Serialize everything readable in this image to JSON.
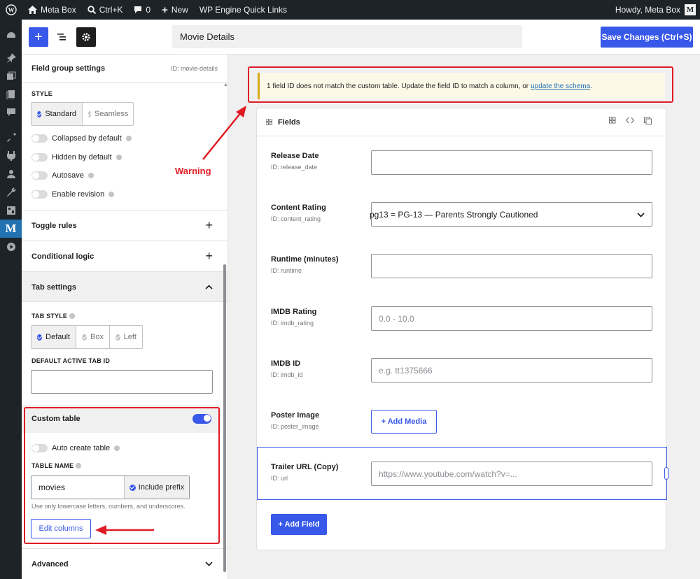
{
  "admin_bar": {
    "site_name": "Meta Box",
    "search_shortcut": "Ctrl+K",
    "comments_count": "0",
    "new_label": "New",
    "quick_links": "WP Engine Quick Links",
    "greeting": "Howdy, Meta Box",
    "avatar_letter": "M"
  },
  "admin_menu": {
    "items": [
      "dashboard-icon",
      "pin-icon",
      "media-icon",
      "pages-icon",
      "comments-icon",
      "appearance-icon",
      "plugins-icon",
      "users-icon",
      "tools-icon",
      "settings-icon",
      "metabox-icon",
      "play-icon"
    ],
    "active_letter": "M"
  },
  "toolbar": {
    "add_label": "+",
    "title_value": "Movie Details",
    "save_label": "Save Changes (Ctrl+S)"
  },
  "sidebar": {
    "header_title": "Field group settings",
    "header_id": "ID: movie-details",
    "style_label": "STYLE",
    "style_options": [
      "Standard",
      "Seamless"
    ],
    "style_selected": "Standard",
    "toggles": [
      {
        "label": "Collapsed by default",
        "on": false
      },
      {
        "label": "Hidden by default",
        "on": false
      },
      {
        "label": "Autosave",
        "on": false
      },
      {
        "label": "Enable revision",
        "on": false
      }
    ],
    "sections": {
      "toggle_rules": "Toggle rules",
      "conditional_logic": "Conditional logic",
      "tab_settings": "Tab settings",
      "advanced": "Advanced"
    },
    "tab_style_label": "TAB STYLE",
    "tab_style_options": [
      "Default",
      "Box",
      "Left"
    ],
    "tab_style_selected": "Default",
    "default_active_tab_label": "DEFAULT ACTIVE TAB ID",
    "default_active_tab_value": "",
    "custom_table": {
      "title": "Custom table",
      "enabled": true,
      "auto_create_label": "Auto create table",
      "table_name_label": "TABLE NAME",
      "table_name_value": "movies",
      "include_prefix_label": "Include prefix",
      "hint": "Use only lowercase letters, numbers, and underscores.",
      "edit_columns_label": "Edit columns"
    }
  },
  "main": {
    "notice_text": "1 field ID does not match the custom table. Update the field ID to match a column, or",
    "notice_link": "update the schema",
    "notice_end": ".",
    "panel_title": "Fields",
    "fields": [
      {
        "label": "Release Date",
        "id": "ID: release_date",
        "value": "",
        "placeholder": ""
      },
      {
        "label": "Content Rating",
        "id": "ID: content_rating",
        "value": "pg13 = PG-13 — Parents Strongly Cautioned",
        "type": "select"
      },
      {
        "label": "Runtime (minutes)",
        "id": "ID: runtime",
        "value": "",
        "placeholder": ""
      },
      {
        "label": "IMDB Rating",
        "id": "ID: imdb_rating",
        "placeholder": "0.0 - 10.0"
      },
      {
        "label": "IMDB ID",
        "id": "ID: imdb_id",
        "placeholder": "e.g. tt1375666"
      },
      {
        "label": "Poster Image",
        "id": "ID: poster_image",
        "button": "+ Add Media"
      },
      {
        "label": "Trailer URL (Copy)",
        "id": "ID: url",
        "placeholder": "https://www.youtube.com/watch?v=..."
      }
    ],
    "add_field_label": "+ Add Field"
  },
  "annotations": {
    "warning_label": "Warning",
    "color": "#e01b24"
  }
}
